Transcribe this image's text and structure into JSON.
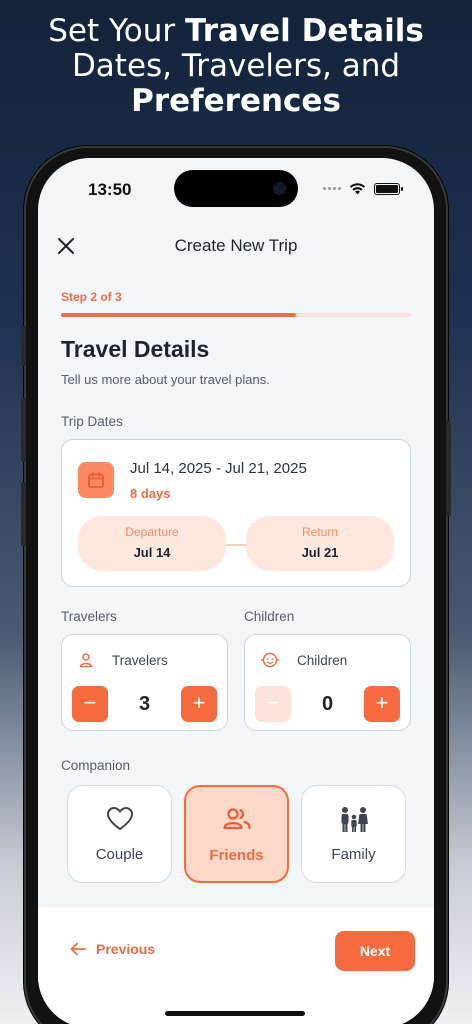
{
  "headline": {
    "line1_normal": "Set Your ",
    "line1_bold": "Travel Details",
    "line2": "Dates, Travelers, and",
    "line3_bold": "Preferences"
  },
  "status_bar": {
    "time": "13:50"
  },
  "nav": {
    "title": "Create New Trip",
    "close_icon": "close-icon"
  },
  "step": {
    "label": "Step 2 of 3",
    "progress": 0.67
  },
  "page": {
    "title": "Travel Details",
    "subtitle": "Tell us more about your travel plans."
  },
  "trip_dates": {
    "label": "Trip Dates",
    "range": "Jul 14, 2025 - Jul 21, 2025",
    "duration": "8 days",
    "departure": {
      "label": "Departure",
      "value": "Jul 14"
    },
    "return": {
      "label": "Return",
      "value": "Jul 21"
    }
  },
  "travelers": {
    "section_label": "Travelers",
    "title": "Travelers",
    "count": "3",
    "minus": "−",
    "plus": "+"
  },
  "children": {
    "section_label": "Children",
    "title": "Children",
    "count": "0",
    "minus": "−",
    "plus": "+"
  },
  "companion": {
    "label": "Companion",
    "options": [
      {
        "label": "Couple",
        "icon": "heart-icon",
        "selected": false
      },
      {
        "label": "Friends",
        "icon": "users-icon",
        "selected": true
      },
      {
        "label": "Family",
        "icon": "family-icon",
        "selected": false
      }
    ]
  },
  "footer": {
    "previous": "Previous",
    "next": "Next"
  },
  "colors": {
    "accent": "#f66a3f",
    "accent_light": "#fde7de",
    "text": "#1e2330"
  }
}
